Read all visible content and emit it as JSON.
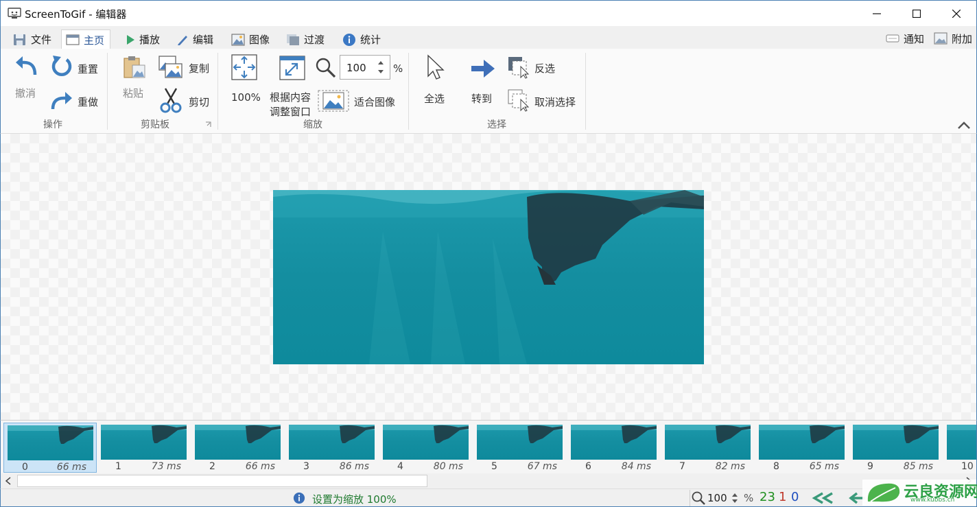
{
  "window": {
    "title": "ScreenToGif - 编辑器"
  },
  "tabs": [
    {
      "label": "文件",
      "icon": "save-icon"
    },
    {
      "label": "主页",
      "icon": "home-icon",
      "active": true
    },
    {
      "label": "播放",
      "icon": "play-icon"
    },
    {
      "label": "编辑",
      "icon": "pencil-icon"
    },
    {
      "label": "图像",
      "icon": "image-icon"
    },
    {
      "label": "过渡",
      "icon": "transition-icon"
    },
    {
      "label": "统计",
      "icon": "info-icon"
    }
  ],
  "right_tabs": [
    {
      "label": "通知",
      "icon": "notification-icon"
    },
    {
      "label": "附加",
      "icon": "extras-icon"
    }
  ],
  "ribbon": {
    "actions": {
      "group": "操作",
      "undo": "撤消",
      "reset": "重置",
      "redo": "重做"
    },
    "clipboard": {
      "group": "剪贴板",
      "paste": "粘贴",
      "copy": "复制",
      "cut": "剪切"
    },
    "zoom": {
      "group": "缩放",
      "full_size": "100%",
      "fit_window_line1": "根据内容",
      "fit_window_line2": "调整窗口",
      "zoom_value": "100",
      "zoom_unit": "%",
      "fit_image": "适合图像"
    },
    "select": {
      "group": "选择",
      "select_all": "全选",
      "go_to": "转到",
      "invert": "反选",
      "deselect": "取消选择"
    }
  },
  "frames": [
    {
      "index": "0",
      "delay": "66 ms",
      "selected": true
    },
    {
      "index": "1",
      "delay": "73 ms"
    },
    {
      "index": "2",
      "delay": "66 ms"
    },
    {
      "index": "3",
      "delay": "86 ms"
    },
    {
      "index": "4",
      "delay": "80 ms"
    },
    {
      "index": "5",
      "delay": "67 ms"
    },
    {
      "index": "6",
      "delay": "84 ms"
    },
    {
      "index": "7",
      "delay": "82 ms"
    },
    {
      "index": "8",
      "delay": "65 ms"
    },
    {
      "index": "9",
      "delay": "85 ms"
    },
    {
      "index": "10",
      "delay": ""
    }
  ],
  "status": {
    "message": "设置为缩放 100%",
    "zoom_value": "100",
    "zoom_unit": "%",
    "frame_count": "23",
    "selected_count": "1",
    "current_frame": "0"
  },
  "watermark": {
    "text": "云良资源网",
    "url": "www.kubbs.cn"
  },
  "colors": {
    "accent": "#2b5797",
    "ribbon_icon": "#3f7fbf",
    "water": "#138fa0",
    "count_green": "#1f8f1f",
    "count_red": "#c0392b",
    "count_blue": "#1f4fbf"
  }
}
